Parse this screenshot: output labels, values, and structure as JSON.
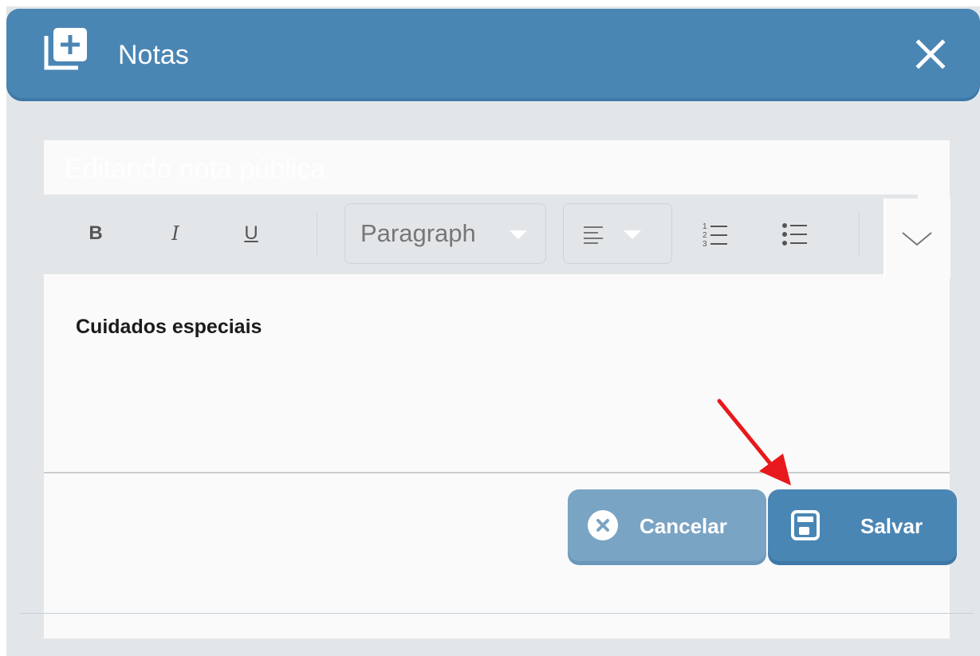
{
  "header": {
    "title": "Notas",
    "add_notes_icon": "add-notes-icon",
    "close_icon": "close-icon"
  },
  "editor": {
    "panel_title": "Editando nota pública",
    "toolbar": {
      "bold": "B",
      "italic": "I",
      "underline": "U",
      "block_format": "Paragraph",
      "align_icon": "align-left-icon",
      "numbered_list_icon": "numbered-list-icon",
      "bulleted_list_icon": "bulleted-list-icon",
      "more_icon": "chevron-down-icon"
    },
    "content": "Cuidados especiais"
  },
  "actions": {
    "cancel_label": "Cancelar",
    "save_label": "Salvar",
    "cancel_icon": "cancel-circle-icon",
    "save_icon": "floppy-disk-icon"
  },
  "colors": {
    "header": "#4a86b4",
    "cancel_button": "#7aa4c3",
    "save_button": "#4a86b4",
    "annotation_arrow": "#e8191c"
  }
}
